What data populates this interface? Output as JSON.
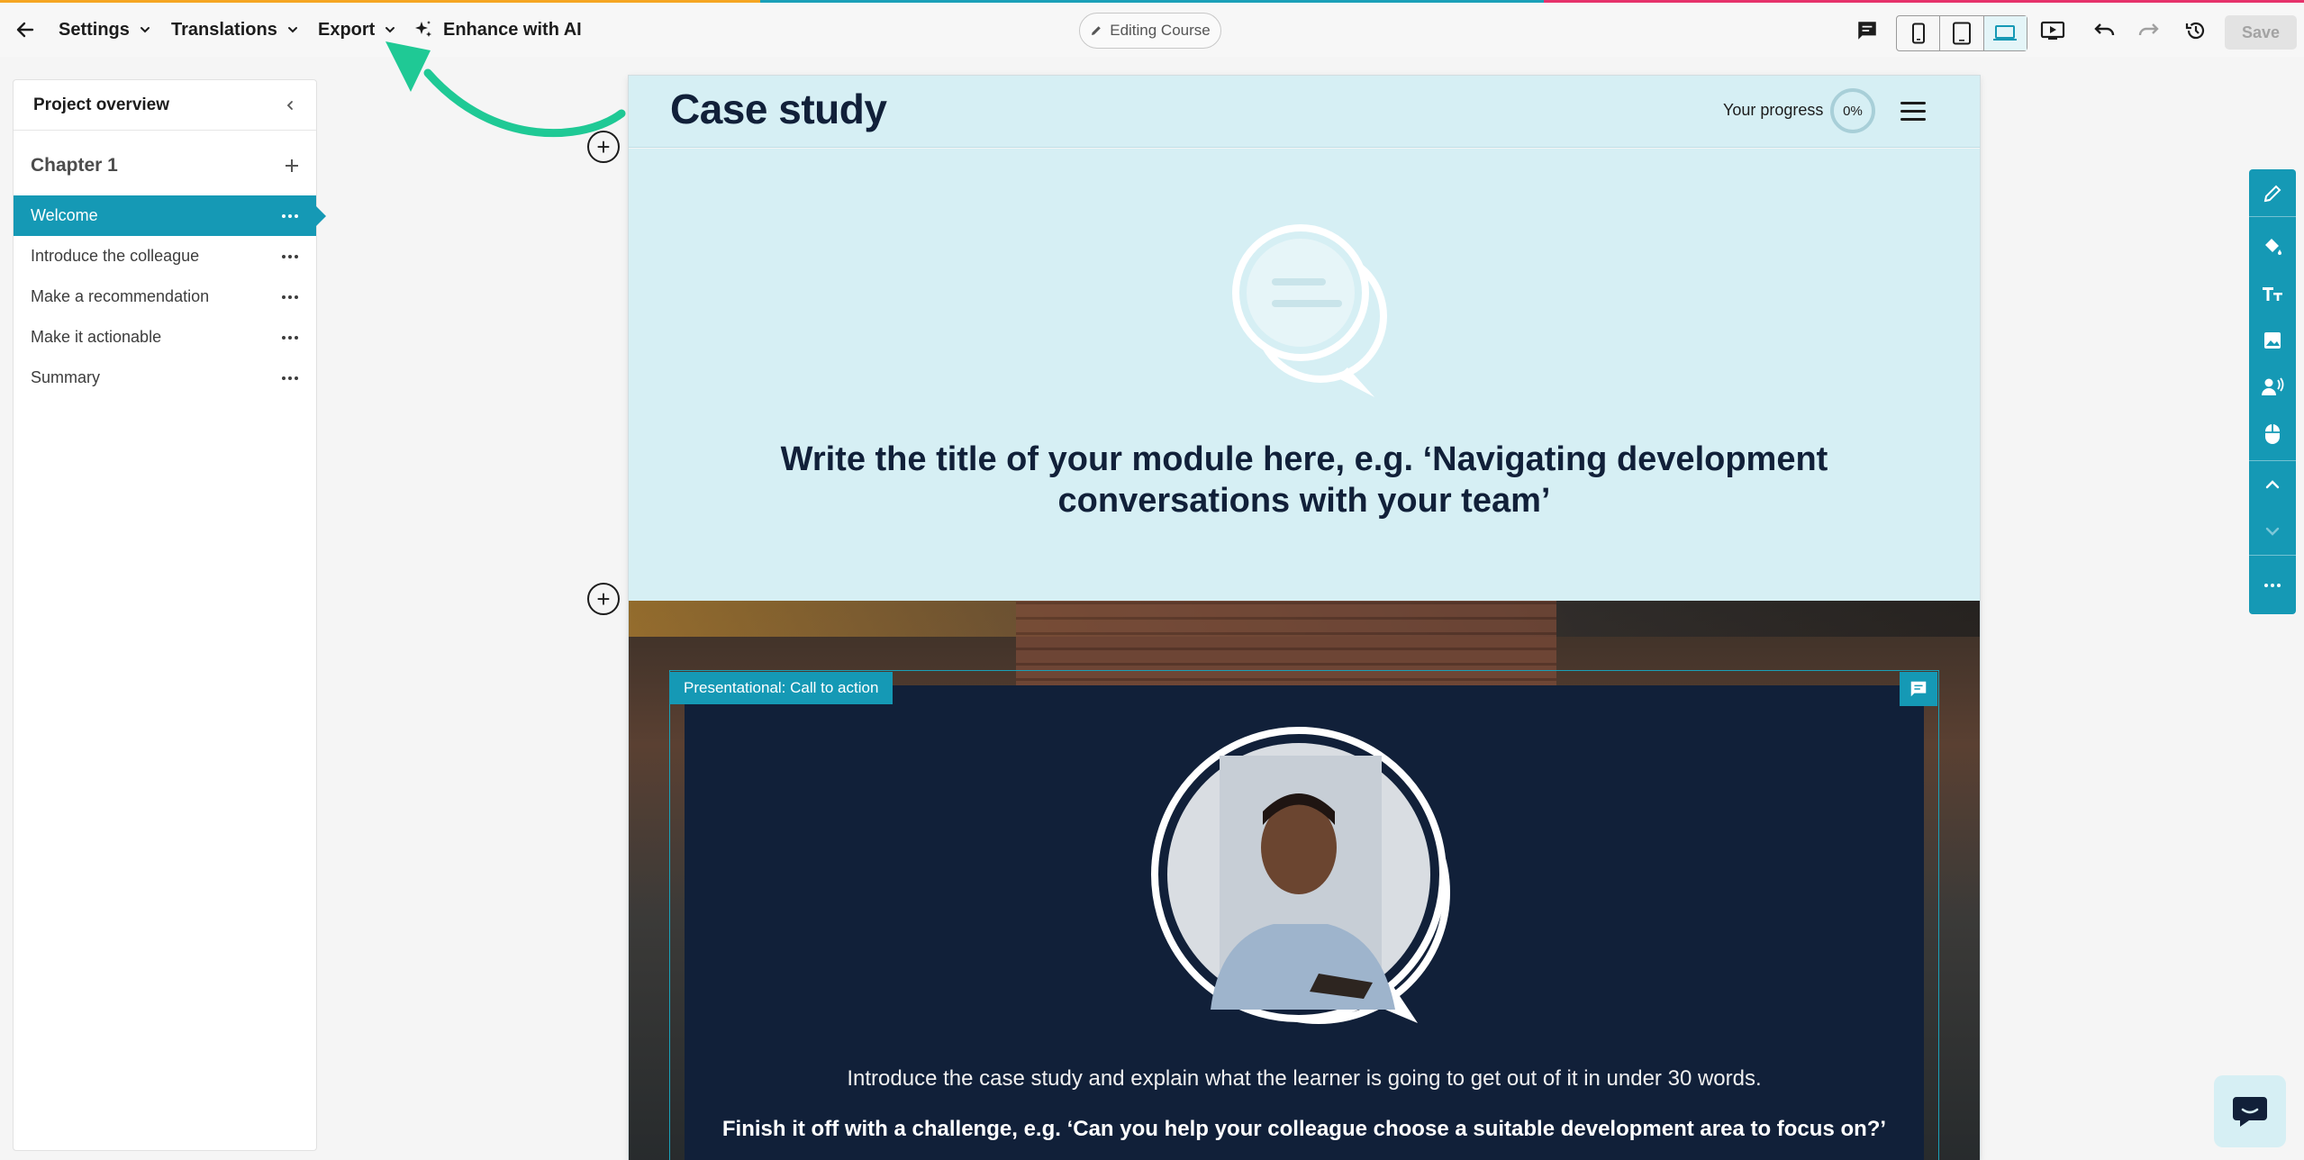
{
  "toolbar": {
    "settings_label": "Settings",
    "translations_label": "Translations",
    "export_label": "Export",
    "enhance_label": "Enhance with AI",
    "editing_label": "Editing Course",
    "save_label": "Save"
  },
  "sidebar": {
    "title": "Project overview",
    "chapter": "Chapter 1",
    "pages": [
      {
        "label": "Welcome",
        "active": true
      },
      {
        "label": "Introduce the colleague",
        "active": false
      },
      {
        "label": "Make a recommendation",
        "active": false
      },
      {
        "label": "Make it actionable",
        "active": false
      },
      {
        "label": "Summary",
        "active": false
      }
    ]
  },
  "course": {
    "title": "Case study",
    "progress_label": "Your progress",
    "progress_value": "0%",
    "module_title": "Write the title of your module here, e.g. ‘Navigating development conversations with your team’",
    "cta_tag": "Presentational: Call to action",
    "cta_text": "Introduce the case study and explain what the learner is going to get out of it in under 30 words.",
    "cta_bold": "Finish it off with a challenge, e.g. ‘Can you help your colleague choose a suitable development area to focus on?’"
  },
  "colors": {
    "accent": "#1599b5",
    "header_bg": "#d6eff4",
    "navy": "#112039",
    "arrow": "#1fc995"
  },
  "icons": {
    "right_toolbar": [
      "edit-pencil-icon",
      "paint-bucket-icon",
      "text-size-icon",
      "image-icon",
      "voice-over-icon",
      "mouse-interaction-icon",
      "move-up-icon",
      "move-down-icon",
      "more-icon"
    ]
  }
}
